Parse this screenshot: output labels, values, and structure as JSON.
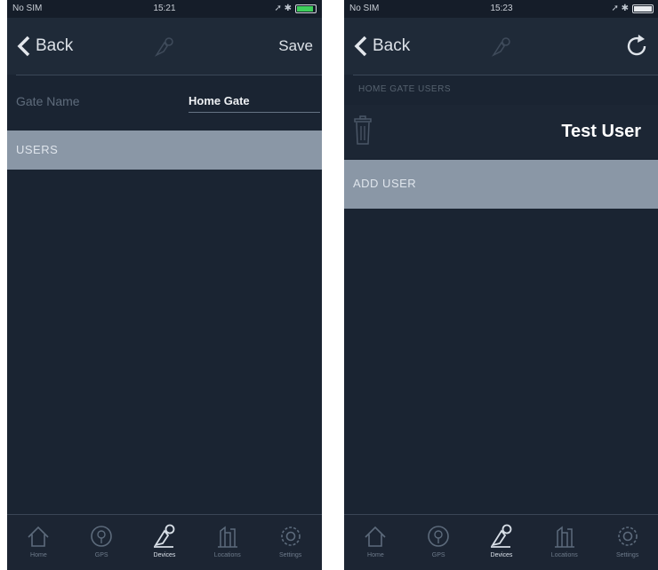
{
  "left": {
    "status": {
      "carrier": "No SIM",
      "time": "15:21"
    },
    "nav": {
      "back_label": "Back",
      "action_label": "Save"
    },
    "form": {
      "gate_name_label": "Gate Name",
      "gate_name_value": "Home Gate"
    },
    "section_label": "USERS"
  },
  "right": {
    "status": {
      "carrier": "No SIM",
      "time": "15:23"
    },
    "nav": {
      "back_label": "Back"
    },
    "header_label": "HOME GATE USERS",
    "user_name": "Test User",
    "add_user_label": "ADD USER"
  },
  "tabs": [
    {
      "icon": "home-icon",
      "label": "Home"
    },
    {
      "icon": "gps-icon",
      "label": "GPS"
    },
    {
      "icon": "devices-icon",
      "label": "Devices"
    },
    {
      "icon": "locations-icon",
      "label": "Locations"
    },
    {
      "icon": "settings-icon",
      "label": "Settings"
    }
  ],
  "active_tab": "Devices",
  "colors": {
    "background": "#1a2432",
    "nav": "#1f2a38",
    "band": "#8a97a6",
    "battery_green": "#3ecf5b"
  }
}
